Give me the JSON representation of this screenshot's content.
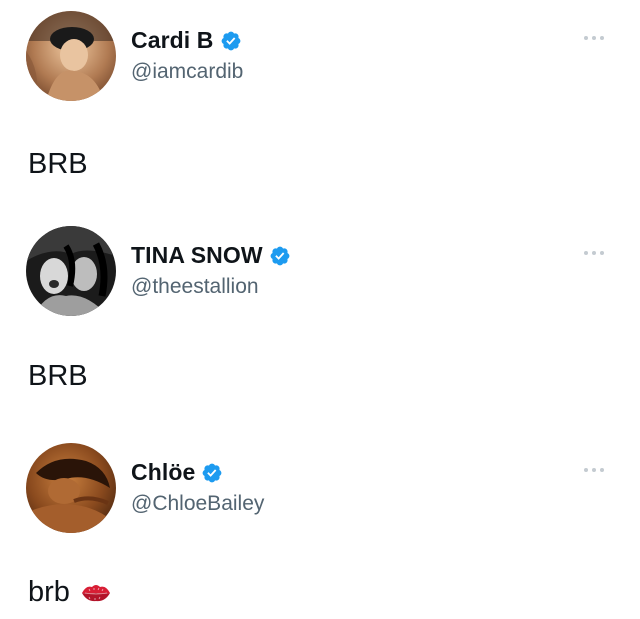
{
  "tweets": [
    {
      "name": "Cardi B",
      "handle": "@iamcardib",
      "text": "BRB",
      "verified_icon": "verified-badge-icon",
      "more_icon": "more-options-icon"
    },
    {
      "name": "TINA SNOW",
      "handle": "@theestallion",
      "text": "BRB",
      "verified_icon": "verified-badge-icon",
      "more_icon": "more-options-icon"
    },
    {
      "name": "Chlöe",
      "handle": "@ChloeBailey",
      "text": "brb",
      "emoji": "kiss-mark-icon",
      "verified_icon": "verified-badge-icon",
      "more_icon": "more-options-icon"
    }
  ],
  "colors": {
    "verified_blue": "#1d9bf0",
    "handle_gray": "#536471",
    "text": "#0f1419",
    "dots": "#c4cbd1",
    "kiss_red": "#d81e35"
  }
}
